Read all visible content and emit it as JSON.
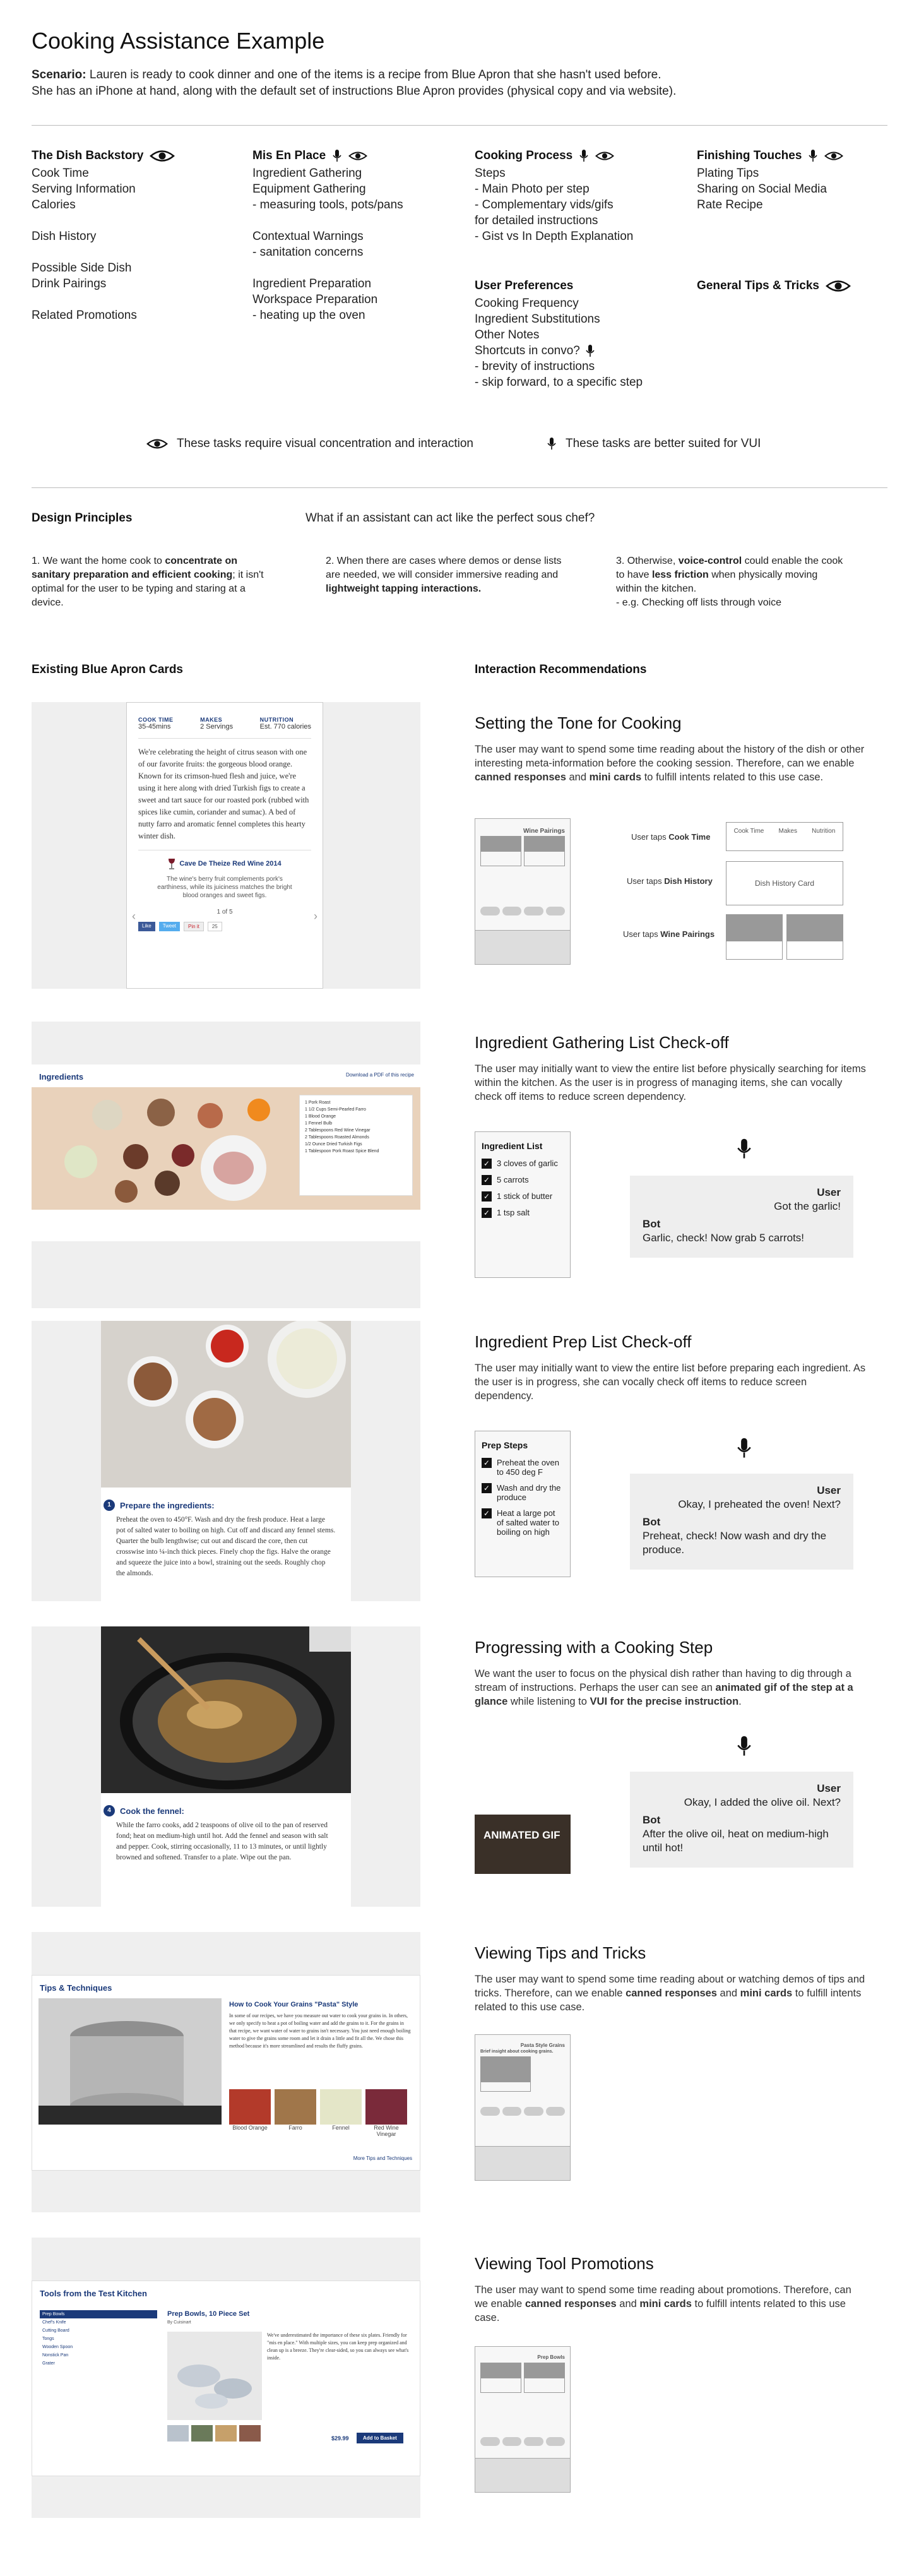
{
  "header": {
    "title": "Cooking Assistance Example",
    "scenario_label": "Scenario:",
    "scenario_text": " Lauren is ready to cook dinner and one of the items is a recipe from Blue Apron that she hasn't used before.",
    "scenario_line2": "She has an iPhone at hand, along with the default set of instructions Blue Apron provides (physical copy and via website)."
  },
  "task_columns": [
    {
      "title": "The Dish Backstory",
      "icons": [
        "eye-icon"
      ],
      "items": [
        "Cook Time",
        "Serving Information",
        "Calories",
        "",
        "Dish History",
        "",
        "Possible Side Dish",
        "Drink Pairings",
        "",
        "Related Promotions"
      ]
    },
    {
      "title": "Mis En Place",
      "icons": [
        "mic-icon",
        "eye-icon"
      ],
      "items": [
        "Ingredient Gathering",
        "Equipment Gathering",
        " - measuring tools, pots/pans",
        "",
        "Contextual Warnings",
        " - sanitation concerns",
        "",
        "Ingredient Preparation",
        "Workspace Preparation",
        " - heating up the oven"
      ]
    },
    {
      "title": "Cooking Process",
      "icons": [
        "mic-icon",
        "eye-icon"
      ],
      "items": [
        "Steps",
        " - Main Photo per step",
        " - Complementary vids/gifs",
        "for detailed instructions",
        " - Gist vs In Depth Explanation"
      ]
    },
    {
      "title": "Finishing Touches",
      "icons": [
        "mic-icon",
        "eye-icon"
      ],
      "items": [
        "Plating Tips",
        "Sharing on Social Media",
        "Rate Recipe"
      ]
    }
  ],
  "user_preferences": {
    "title": "User Preferences",
    "items": [
      "Cooking Frequency",
      "Ingredient Substitutions",
      "Other Notes",
      "Shortcuts in convo?",
      " - brevity of instructions",
      " - skip forward, to a specific step"
    ]
  },
  "general_tips": {
    "title": "General Tips & Tricks"
  },
  "legend": {
    "visual": "These tasks require visual concentration and interaction",
    "vui": "These tasks are better suited for VUI"
  },
  "design_principles": {
    "title": "Design Principles",
    "question": "What if an assistant can act like the perfect sous chef?",
    "p1_a": "1. We want the home cook to ",
    "p1_b": "concentrate on sanitary preparation and efficient cooking",
    "p1_c": "; it isn't optimal for the user to be typing and staring at a device.",
    "p2_a": "2. When there are cases where demos or dense lists are needed, we will consider immersive reading and ",
    "p2_b": "lightweight tapping interactions.",
    "p3_a": "3. Otherwise, ",
    "p3_b": "voice-control",
    "p3_c": " could enable the cook to have ",
    "p3_d": "less friction",
    "p3_e": " when physically moving within the kitchen.",
    "p3_f": "  - e.g. Checking off lists through voice"
  },
  "columns_header": {
    "left": "Existing Blue Apron Cards",
    "right": "Interaction Recommendations"
  },
  "card1": {
    "cook_time_label": "COOK TIME",
    "cook_time": "35-45mins",
    "makes_label": "MAKES",
    "makes": "2 Servings",
    "nutrition_label": "NUTRITION",
    "nutrition": "Est. 770 calories",
    "body": "We're celebrating the height of citrus season with one of our favorite fruits: the gorgeous blood orange. Known for its crimson-hued flesh and juice, we're using it here along with dried Turkish figs to create a sweet and tart sauce for our roasted pork (rubbed with spices like cumin, coriander and sumac). A bed of nutty farro and aromatic fennel completes this hearty winter dish.",
    "wine_title": "Cave De Theize Red Wine 2014",
    "wine_desc": "The wine's berry fruit complements pork's earthiness, while its juiciness matches the bright blood oranges and sweet figs.",
    "pager": "1 of 5",
    "social": [
      "Like",
      "Tweet",
      "Pin it",
      "25"
    ]
  },
  "rec1": {
    "title": "Setting the Tone for Cooking",
    "desc_a": "The user may want to spend some time reading about the history of the dish or other interesting meta-information before the cooking session. Therefore, can we enable ",
    "desc_b": "canned responses",
    "desc_c": " and ",
    "desc_d": "mini cards",
    "desc_e": " to fulfill intents related to this use case.",
    "phone_label": "Wine Pairings",
    "tap1_a": "User taps ",
    "tap1_b": "Cook Time",
    "tap2_a": "User taps ",
    "tap2_b": "Dish History",
    "tap3_a": "User taps ",
    "tap3_b": "Wine Pairings",
    "mini_tabs": [
      "Cook Time",
      "Makes",
      "Nutrition"
    ],
    "dish_history_card": "Dish History Card"
  },
  "card2": {
    "title": "Ingredients",
    "right_link": "Download a PDF of this recipe",
    "list": [
      "1 Pork Roast",
      "1 1/2 Cups Semi-Pearled Farro",
      "1 Blood Orange",
      "1 Fennel Bulb",
      "2 Tablespoons Red Wine Vinegar",
      "2 Tablespoons Roasted Almonds",
      "1/2 Ounce Dried Turkish Figs",
      "1 Tablespoon Pork Roast Spice Blend"
    ]
  },
  "rec2": {
    "title": "Ingredient Gathering List Check-off",
    "desc": "The user may initially want to view the entire list before physically searching for items within the kitchen.  As the user is in progress of managing items, she can vocally check off items to reduce screen dependency.",
    "list_title": "Ingredient List",
    "items": [
      "3 cloves of garlic",
      "5 carrots",
      "1 stick of butter",
      "1 tsp salt"
    ],
    "user_label": "User",
    "user_text": "Got the garlic!",
    "bot_label": "Bot",
    "bot_text": "Garlic, check!  Now grab 5 carrots!"
  },
  "card3": {
    "step_num": "1",
    "step_title": "Prepare the ingredients:",
    "body": "Preheat the oven to 450°F. Wash and dry the fresh produce. Heat a large pot of salted water to boiling on high. Cut off and discard any fennel stems. Quarter the bulb lengthwise; cut out and discard the core, then cut crosswise into ¼-inch thick pieces. Finely chop the figs. Halve the orange and squeeze the juice into a bowl, straining out the seeds. Roughly chop the almonds."
  },
  "rec3": {
    "title": "Ingredient Prep List Check-off",
    "desc": "The user may initially want to view the entire list before preparing each ingredient.  As the user is in progress, she can vocally check off items to reduce screen dependency.",
    "list_title": "Prep Steps",
    "items": [
      "Preheat the oven to 450 deg F",
      "Wash and dry the produce",
      "Heat a large pot of salted water to boiling on high"
    ],
    "user_label": "User",
    "user_text": "Okay, I preheated the oven! Next?",
    "bot_label": "Bot",
    "bot_text": "Preheat, check!  Now wash and dry the produce."
  },
  "card4": {
    "step_num": "4",
    "step_title": "Cook the fennel:",
    "body": "While the farro cooks, add 2 teaspoons of olive oil to the pan of reserved fond; heat on medium-high until hot. Add the fennel and season with salt and pepper. Cook, stirring occasionally, 11 to 13 minutes, or until lightly browned and softened. Transfer to a plate. Wipe out the pan."
  },
  "rec4": {
    "title": "Progressing with a Cooking Step",
    "desc_a": "We want the user to focus on the physical dish rather than having to dig through a stream of instructions.  Perhaps the user can see an ",
    "desc_b": "animated gif of the step at a glance",
    "desc_c": " while listening to ",
    "desc_d": "VUI for the precise instruction",
    "desc_e": ".",
    "gif_label": "ANIMATED GIF",
    "user_label": "User",
    "user_text": "Okay, I added the olive oil.  Next?",
    "bot_label": "Bot",
    "bot_text": "After the olive oil, heat on medium-high until hot!"
  },
  "card5": {
    "title": "Tips & Techniques",
    "article_title": "How to Cook Your Grains \"Pasta\" Style",
    "article_body": "In some of our recipes, we have you measure out water to cook your grains in. In others, we only specify to heat a pot of boiling water and add the grains to it. For the grains in that recipe, we want water of water to grains isn't necessary. You just need enough boiling water to give the grains some room and let it drain a little and fit all the. We chose this method because it's more streamlined and results the fluffy grains.",
    "thumbs": [
      "Blood Orange",
      "Farro",
      "Fennel",
      "Red Wine Vinegar"
    ],
    "more_link": "More Tips and Techniques"
  },
  "rec5": {
    "title": "Viewing Tips and Tricks",
    "desc_a": "The user may want to spend some time reading about or watching demos of tips and tricks.  Therefore, can we enable ",
    "desc_b": "canned responses",
    "desc_c": " and ",
    "desc_d": "mini cards",
    "desc_e": " to fulfill intents related to this use case.",
    "phone_title": "Pasta Style Grains",
    "phone_sub": "Brief insight about cooking grains."
  },
  "card6": {
    "title": "Tools from the Test Kitchen",
    "sidebar": [
      "Prep Bowls",
      "Chef's Knife",
      "Cutting Board",
      "Tongs",
      "Wooden Spoon",
      "Nonstick Pan",
      "Grater"
    ],
    "product_title": "Prep Bowls, 10 Piece Set",
    "product_by": "By Cuisinart",
    "product_body": "We've underestimated the importance of these six plates. Friendly for \"mis en place.\" With multiple sizes, you can keep prep organized and clean up is a breeze. They're clear-sided, so you can always see what's inside.",
    "price": "$29.99",
    "cta": "Add to Basket"
  },
  "rec6": {
    "title": "Viewing Tool Promotions",
    "desc_a": "The user may want to spend some time reading about promotions. Therefore, can we enable ",
    "desc_b": "canned responses",
    "desc_c": " and ",
    "desc_d": "mini cards",
    "desc_e": " to fulfill intents related to this use case.",
    "phone_title": "Prep Bowls"
  },
  "colors": {
    "blue_apron": "#1b3a7a",
    "panel_gray": "#efefef",
    "bot_gray": "#eeeeee"
  }
}
